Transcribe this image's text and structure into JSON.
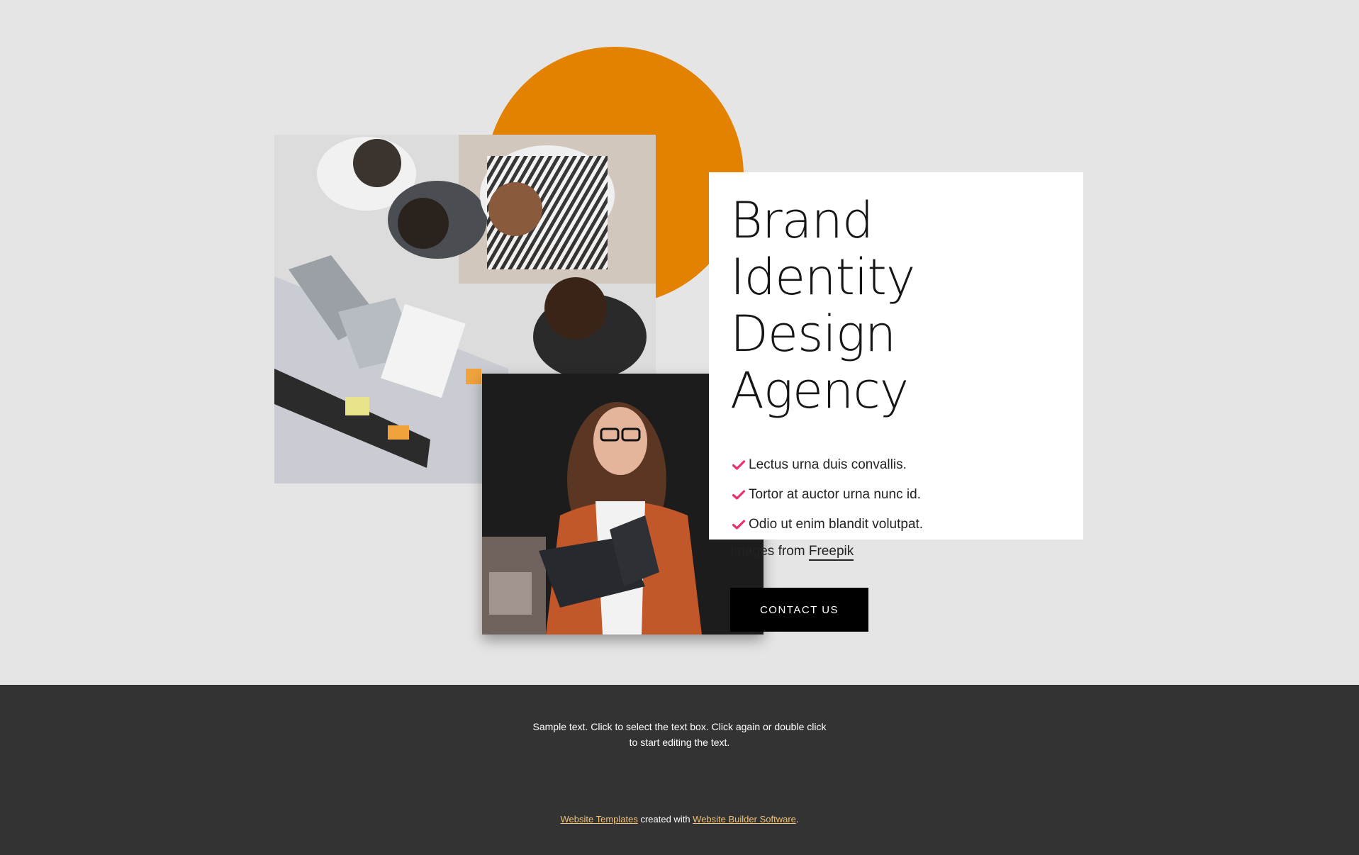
{
  "hero": {
    "title_line1": "Brand Identity",
    "title_line2": "Design Agency",
    "bullets": [
      "Lectus urna duis convallis.",
      "Tortor at auctor urna nunc id.",
      "Odio ut enim blandit volutpat."
    ],
    "credit_prefix": "Images from",
    "credit_link": "Freepik",
    "cta_label": "CONTACT US",
    "accent_color": "#e38100",
    "check_color": "#e8336e"
  },
  "images": {
    "team_alt": "Team working together at laptops, viewed from above",
    "woman_alt": "Smiling woman in orange jacket holding a tablet"
  },
  "footer": {
    "sample_text": "Sample text. Click to select the text box. Click again or double click to start editing the text.",
    "link1": "Website Templates",
    "middle": " created with ",
    "link2": "Website Builder Software",
    "end": "."
  }
}
